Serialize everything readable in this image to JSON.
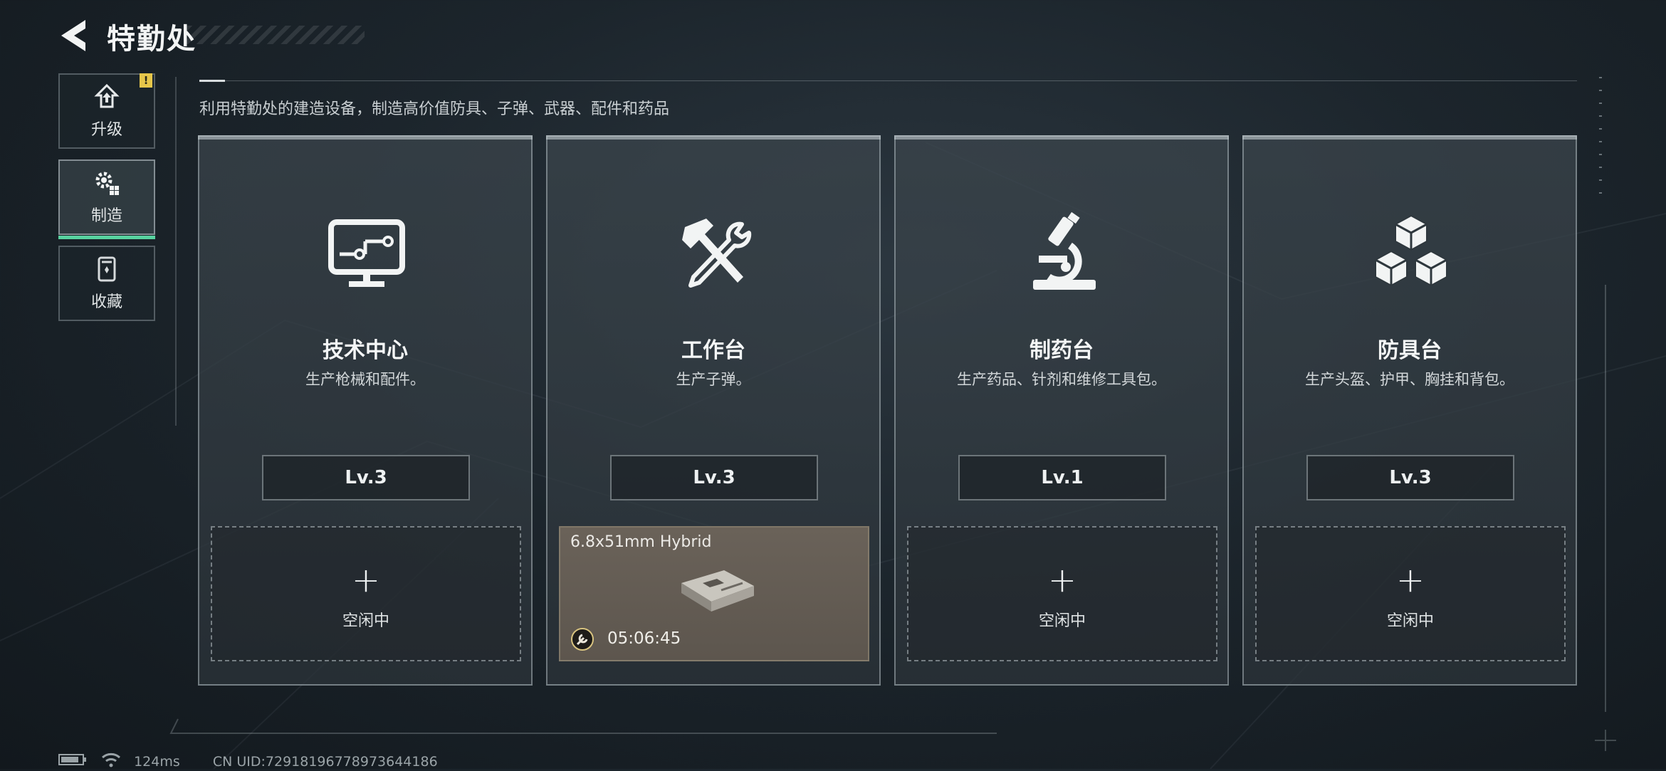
{
  "header": {
    "title": "特勤处"
  },
  "sidebar": {
    "items": [
      {
        "label": "升级",
        "icon": "upgrade-icon",
        "alert": "!"
      },
      {
        "label": "制造",
        "icon": "gears-icon",
        "active": true
      },
      {
        "label": "收藏",
        "icon": "collection-icon"
      }
    ]
  },
  "description": "利用特勤处的建造设备，制造高价值防具、子弹、武器、配件和药品",
  "cards": [
    {
      "name": "技术中心",
      "sub": "生产枪械和配件。",
      "level": "Lv.3",
      "icon": "computer-icon",
      "slot": {
        "plus": "+",
        "status": "空闲中"
      }
    },
    {
      "name": "工作台",
      "sub": "生产子弹。",
      "level": "Lv.3",
      "icon": "hammer-wrench-icon",
      "slot": {
        "item": "6.8x51mm Hybrid",
        "timer": "05:06:45",
        "icon": "ammo-box-icon"
      }
    },
    {
      "name": "制药台",
      "sub": "生产药品、针剂和维修工具包。",
      "level": "Lv.1",
      "icon": "microscope-icon",
      "slot": {
        "plus": "+",
        "status": "空闲中"
      }
    },
    {
      "name": "防具台",
      "sub": "生产头盔、护甲、胸挂和背包。",
      "level": "Lv.3",
      "icon": "cubes-icon",
      "slot": {
        "plus": "+",
        "status": "空闲中"
      }
    }
  ],
  "footer": {
    "ping": "124ms",
    "uid": "CN UID:7291819677897364418​6"
  },
  "colors": {
    "accent": "#58d3a0",
    "alert": "#e6c64a",
    "busy_slot": "#6a6259"
  }
}
